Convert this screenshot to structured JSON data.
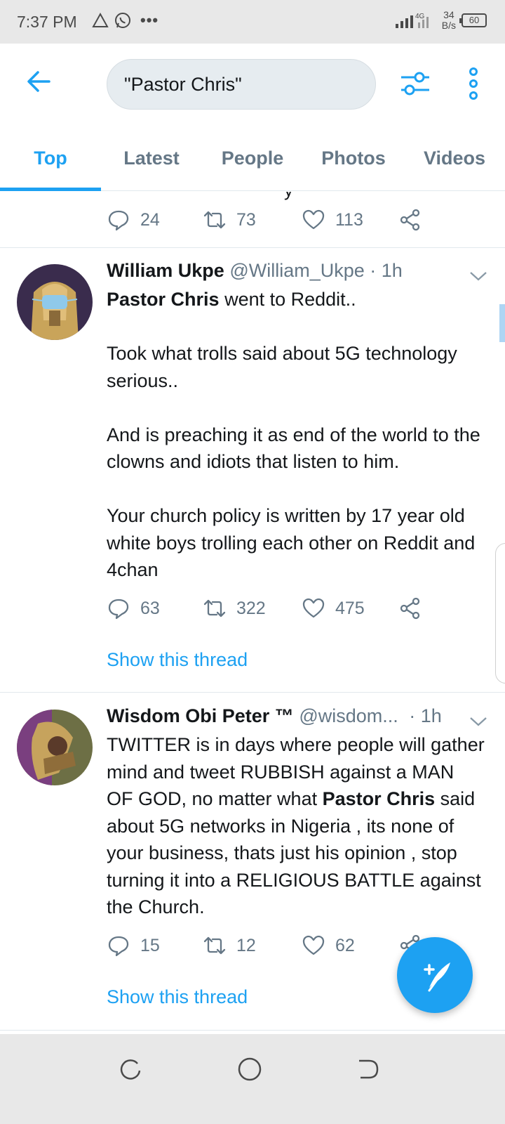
{
  "status_bar": {
    "time": "7:37 PM",
    "net_speed_value": "34",
    "net_speed_unit": "B/s",
    "network_label": "4G",
    "battery": "60"
  },
  "search": {
    "query": "\"Pastor Chris\""
  },
  "tabs": [
    {
      "label": "Top",
      "active": true
    },
    {
      "label": "Latest",
      "active": false
    },
    {
      "label": "People",
      "active": false
    },
    {
      "label": "Photos",
      "active": false
    },
    {
      "label": "Videos",
      "active": false
    }
  ],
  "partial_tweet": {
    "cut_text": "y",
    "replies": "24",
    "retweets": "73",
    "likes": "113"
  },
  "tweets": [
    {
      "name": "William Ukpe",
      "handle": "@William_Ukpe",
      "time": "· 1h",
      "body_bold_lead": "Pastor Chris",
      "body_rest": " went to Reddit..\n\nTook what trolls said about 5G technology serious..\n\nAnd is preaching it as end of the world to the clowns and idiots that listen to him.\n\nYour church policy is written by 17 year old white boys trolling each other on Reddit and 4chan",
      "replies": "63",
      "retweets": "322",
      "likes": "475",
      "show_thread": "Show this thread"
    },
    {
      "name": "Wisdom Obi Peter ™",
      "handle": "@wisdom...",
      "time": "· 1h",
      "body_part1": "TWITTER is in days where people will gather mind and tweet RUBBISH against a MAN OF GOD, no matter what ",
      "body_bold": "Pastor Chris",
      "body_part2": " said about 5G networks in Nigeria , its none of your business, thats just his opinion , stop turning it into a RELIGIOUS BATTLE against the Church.",
      "replies": "15",
      "retweets": "12",
      "likes": "62",
      "show_thread": "Show this thread"
    }
  ],
  "colors": {
    "accent": "#1da1f2",
    "secondary_text": "#657786",
    "primary_text": "#14171a"
  }
}
